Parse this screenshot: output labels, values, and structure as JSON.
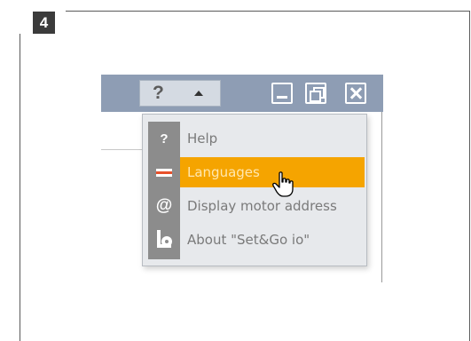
{
  "step": {
    "number": "4"
  },
  "titlebar": {
    "help_button_label": "?",
    "minimize_icon": "minimize-icon",
    "restore_icon": "restore-icon",
    "close_icon": "close-icon"
  },
  "menu": {
    "items": [
      {
        "label": "Help",
        "icon": "question-icon",
        "active": false
      },
      {
        "label": "Languages",
        "icon": "languages-icon",
        "active": true
      },
      {
        "label": "Display motor address",
        "icon": "at-icon",
        "active": false
      },
      {
        "label": "About \"Set&Go io\"",
        "icon": "about-icon",
        "active": false
      }
    ]
  },
  "colors": {
    "titlebar": "#8e9db4",
    "highlight": "#f5a400",
    "icon_column": "#8c8c8c",
    "menu_background": "#e7e9ec"
  }
}
